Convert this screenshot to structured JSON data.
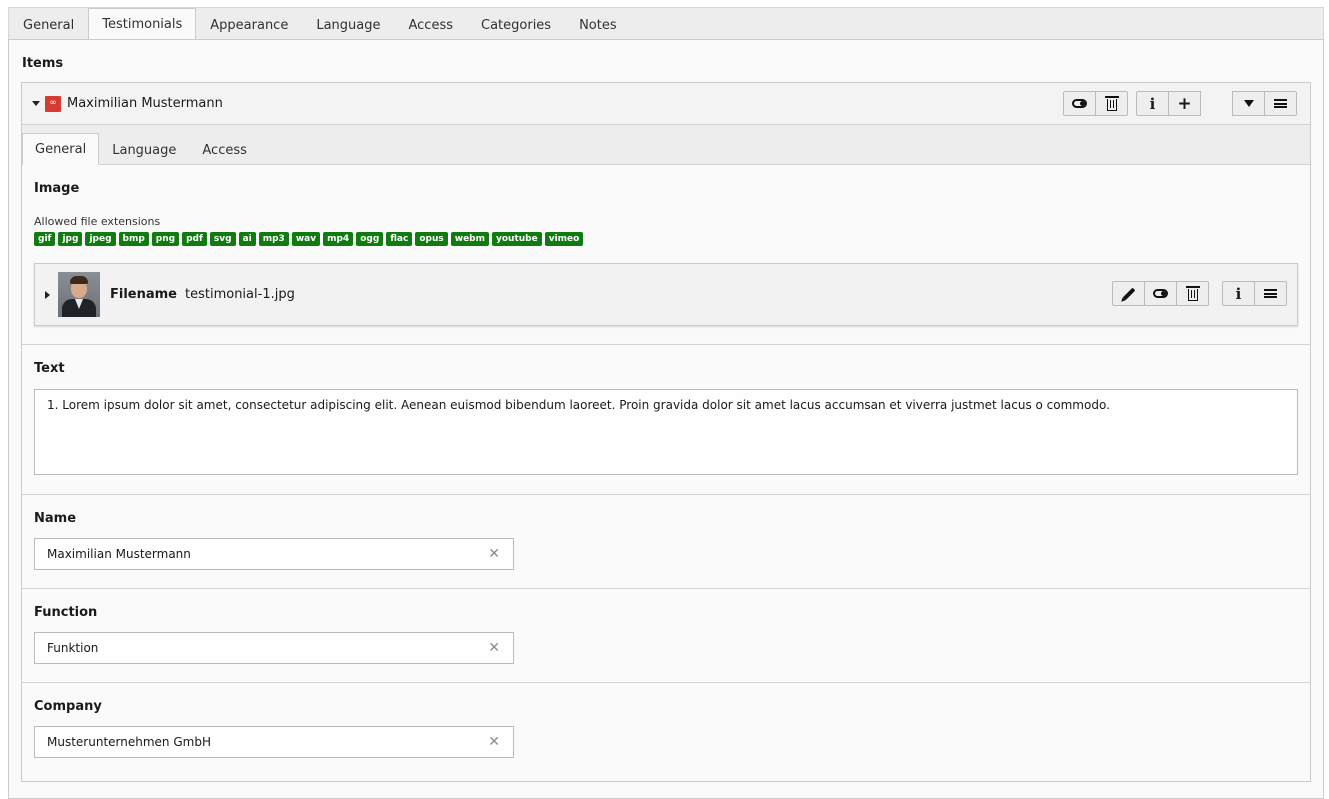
{
  "top_tabs": [
    "General",
    "Testimonials",
    "Appearance",
    "Language",
    "Access",
    "Categories",
    "Notes"
  ],
  "items_label": "Items",
  "item": {
    "title": "Maximilian Mustermann",
    "controls": {
      "toggle": "toggle-icon",
      "delete": "trash-icon",
      "info": "i",
      "add": "+",
      "move_down": "caret-down-icon",
      "drag": "menu-icon"
    }
  },
  "sub_tabs": [
    "General",
    "Language",
    "Access"
  ],
  "image": {
    "label": "Image",
    "allowed_hint": "Allowed file extensions",
    "extensions": [
      "gif",
      "jpg",
      "jpeg",
      "bmp",
      "png",
      "pdf",
      "svg",
      "ai",
      "mp3",
      "wav",
      "mp4",
      "ogg",
      "flac",
      "opus",
      "webm",
      "youtube",
      "vimeo"
    ],
    "file": {
      "label": "Filename",
      "name": "testimonial-1.jpg"
    }
  },
  "text": {
    "label": "Text",
    "value": "1. Lorem ipsum dolor sit amet, consectetur adipiscing elit. Aenean euismod bibendum laoreet. Proin gravida dolor sit amet lacus accumsan et viverra justmet lacus o commodo."
  },
  "name_field": {
    "label": "Name",
    "value": "Maximilian Mustermann"
  },
  "function_field": {
    "label": "Function",
    "value": "Funktion"
  },
  "company_field": {
    "label": "Company",
    "value": "Musterunternehmen GmbH"
  },
  "colors": {
    "badge": "#107c10",
    "record_icon": "#d63a32"
  }
}
